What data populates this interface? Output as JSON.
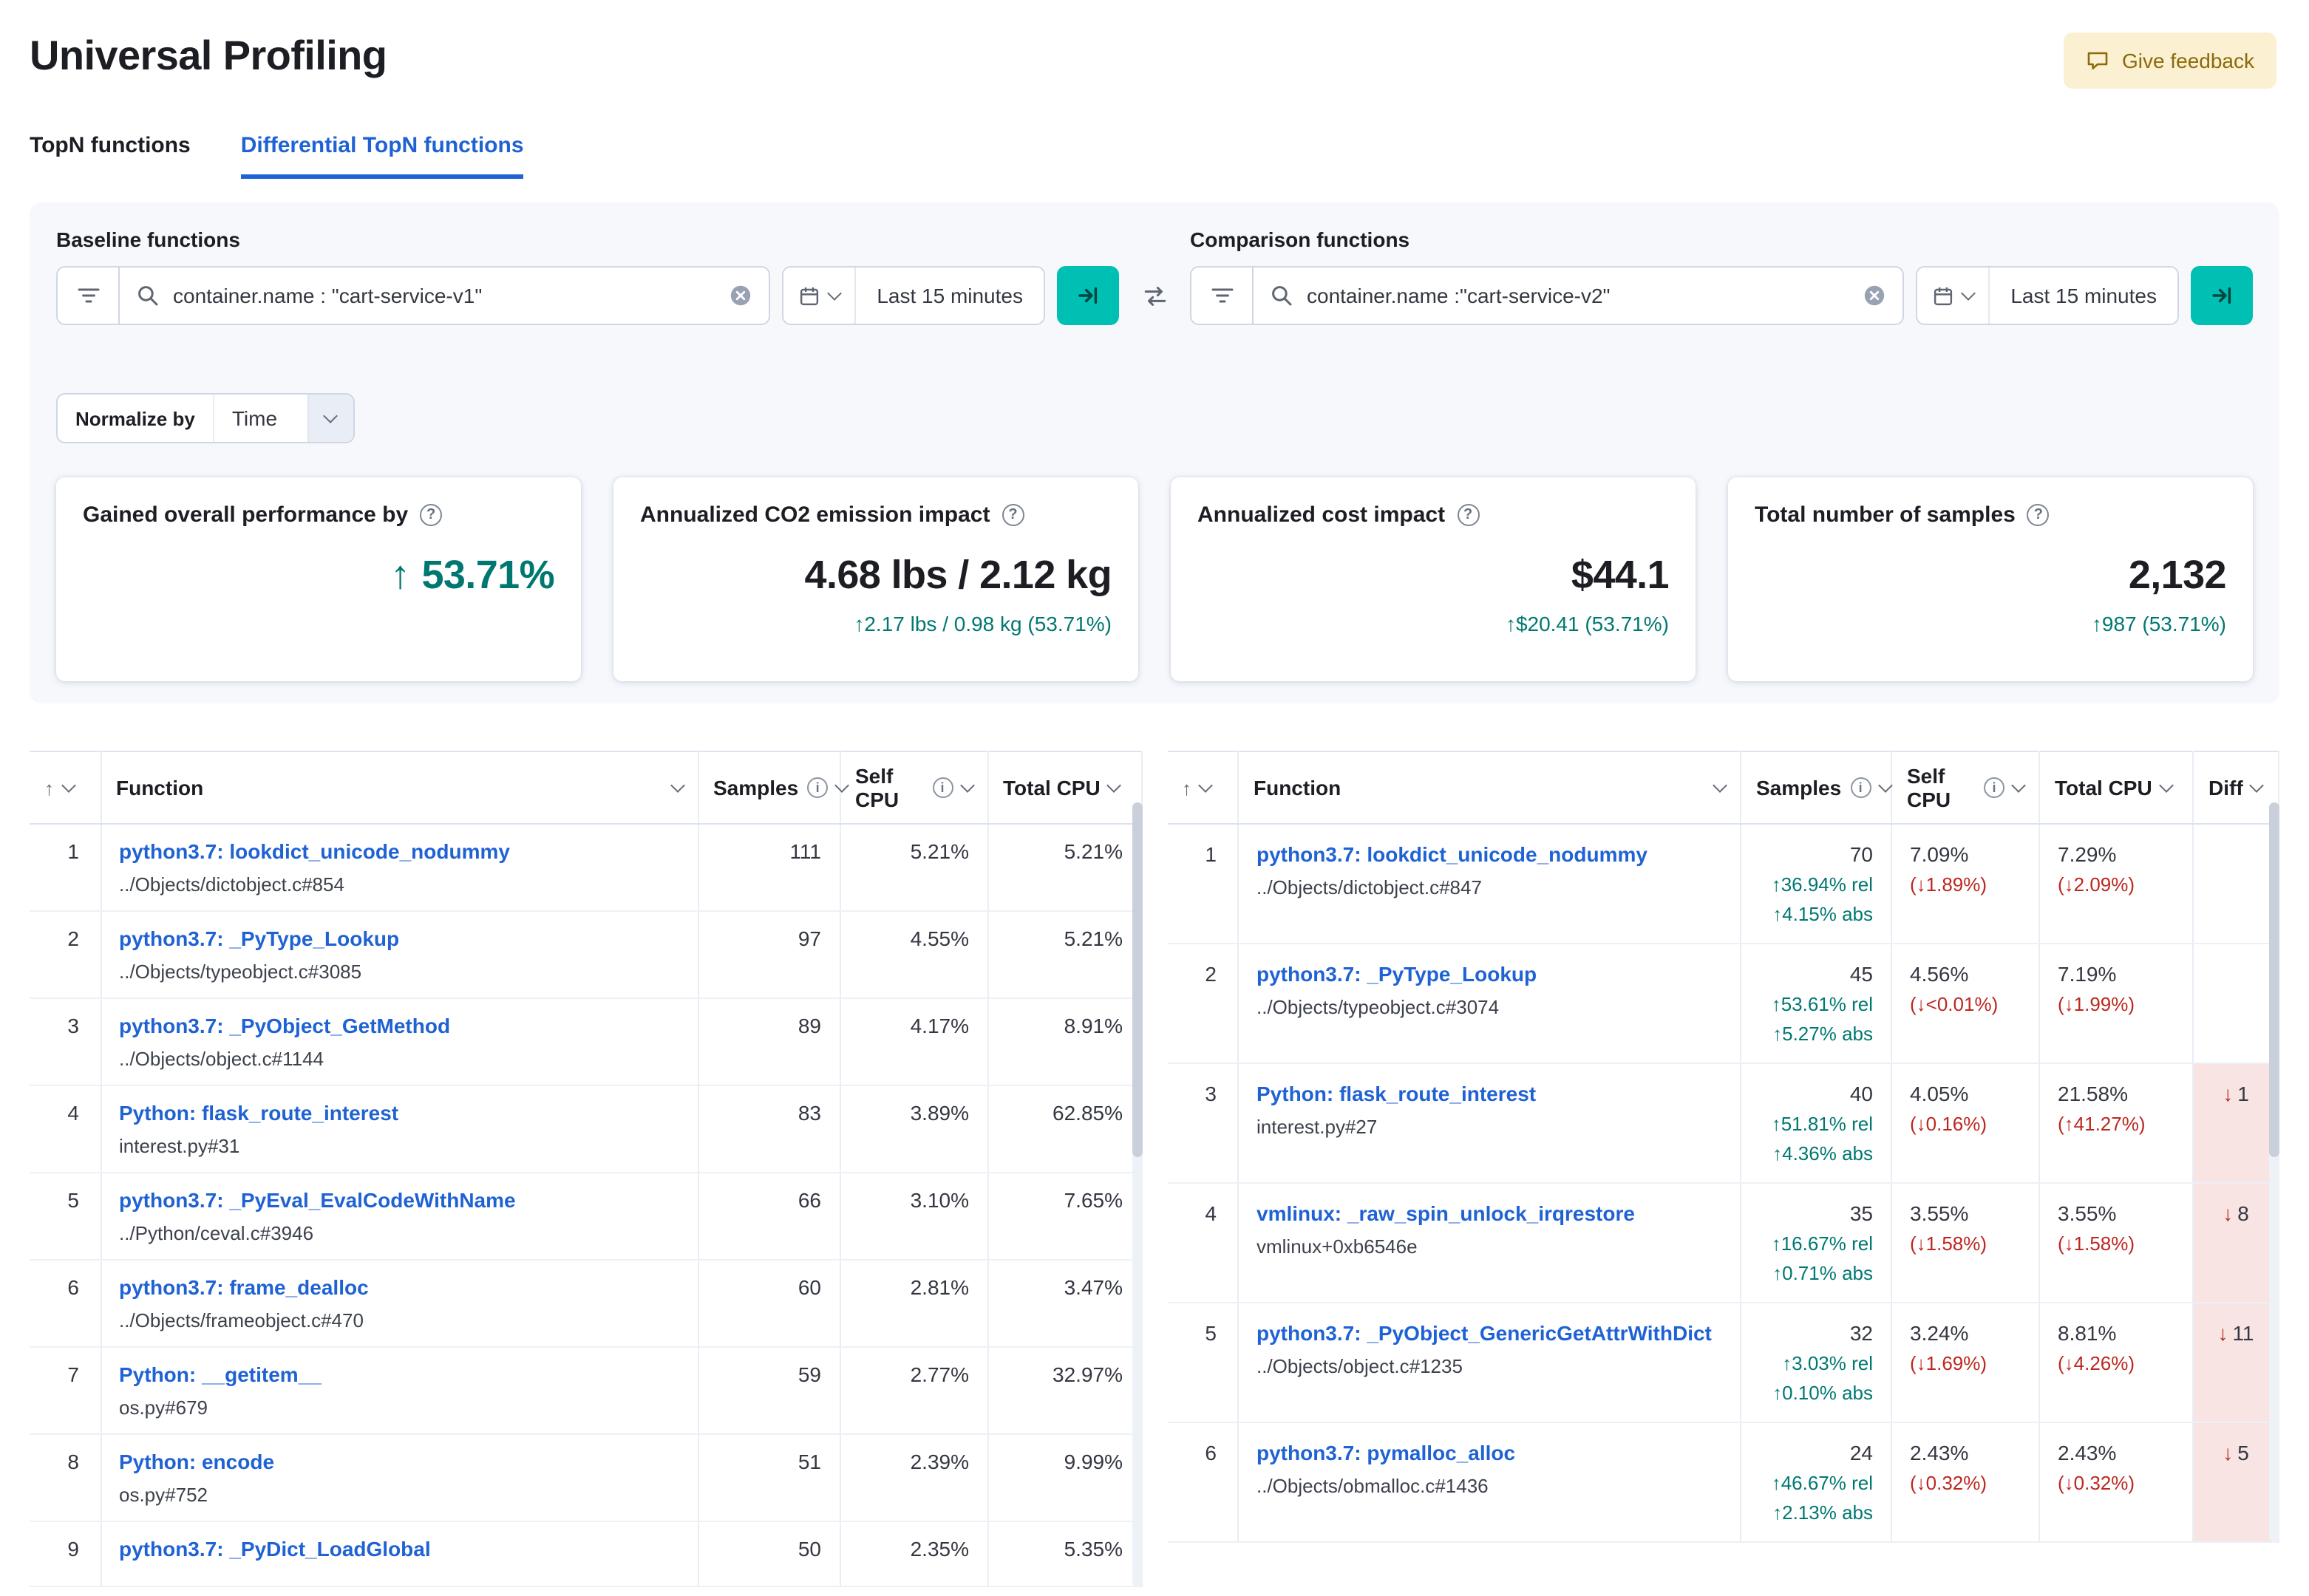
{
  "colors": {
    "accent_green": "#007871",
    "danger_red": "#bd271e",
    "link_blue": "#1f62d4",
    "teal_button": "#00bfb3",
    "diff_bad_bg": "#f7e4e3",
    "feedback_bg": "#fbf0d2",
    "feedback_text": "#8a6a0a",
    "panel_bg": "#f6f8fc"
  },
  "icons": {
    "help": "?",
    "info": "i",
    "sort_asc": "↑"
  },
  "header": {
    "title": "Universal Profiling",
    "feedback_label": "Give feedback"
  },
  "tabs": [
    {
      "label": "TopN functions"
    },
    {
      "label": "Differential TopN functions"
    }
  ],
  "baseline": {
    "label": "Baseline functions",
    "query": "container.name : \"cart-service-v1\"",
    "time_range": "Last 15 minutes"
  },
  "comparison": {
    "label": "Comparison functions",
    "query": "container.name :\"cart-service-v2\"",
    "time_range": "Last 15 minutes"
  },
  "normalize": {
    "label": "Normalize by",
    "value": "Time"
  },
  "cards": [
    {
      "title": "Gained overall performance by",
      "arrow": "↑",
      "value": "53.71%"
    },
    {
      "title": "Annualized CO2 emission impact",
      "value": "4.68 lbs / 2.12 kg",
      "delta": "↑2.17 lbs / 0.98 kg (53.71%)"
    },
    {
      "title": "Annualized cost impact",
      "value": "$44.1",
      "delta": "↑$20.41 (53.71%)"
    },
    {
      "title": "Total number of samples",
      "value": "2,132",
      "delta": "↑987 (53.71%)"
    }
  ],
  "baseline_table": {
    "headers": {
      "function": "Function",
      "samples": "Samples",
      "self_cpu": "Self CPU",
      "total_cpu": "Total CPU"
    },
    "rows": [
      {
        "rank": 1,
        "function": "python3.7: lookdict_unicode_nodummy",
        "file": "../Objects/dictobject.c#854",
        "samples": "111",
        "self_cpu": "5.21%",
        "total_cpu": "5.21%"
      },
      {
        "rank": 2,
        "function": "python3.7: _PyType_Lookup",
        "file": "../Objects/typeobject.c#3085",
        "samples": "97",
        "self_cpu": "4.55%",
        "total_cpu": "5.21%"
      },
      {
        "rank": 3,
        "function": "python3.7: _PyObject_GetMethod",
        "file": "../Objects/object.c#1144",
        "samples": "89",
        "self_cpu": "4.17%",
        "total_cpu": "8.91%"
      },
      {
        "rank": 4,
        "function": "Python: flask_route_interest",
        "file": "interest.py#31",
        "samples": "83",
        "self_cpu": "3.89%",
        "total_cpu": "62.85%"
      },
      {
        "rank": 5,
        "function": "python3.7: _PyEval_EvalCodeWithName",
        "file": "../Python/ceval.c#3946",
        "samples": "66",
        "self_cpu": "3.10%",
        "total_cpu": "7.65%"
      },
      {
        "rank": 6,
        "function": "python3.7: frame_dealloc",
        "file": "../Objects/frameobject.c#470",
        "samples": "60",
        "self_cpu": "2.81%",
        "total_cpu": "3.47%"
      },
      {
        "rank": 7,
        "function": "Python: __getitem__",
        "file": "os.py#679",
        "samples": "59",
        "self_cpu": "2.77%",
        "total_cpu": "32.97%"
      },
      {
        "rank": 8,
        "function": "Python: encode",
        "file": "os.py#752",
        "samples": "51",
        "self_cpu": "2.39%",
        "total_cpu": "9.99%"
      },
      {
        "rank": 9,
        "function": "python3.7: _PyDict_LoadGlobal",
        "file": "",
        "samples": "50",
        "self_cpu": "2.35%",
        "total_cpu": "5.35%"
      }
    ]
  },
  "comparison_table": {
    "headers": {
      "function": "Function",
      "samples": "Samples",
      "self_cpu": "Self CPU",
      "total_cpu": "Total CPU",
      "diff": "Diff"
    },
    "rows": [
      {
        "rank": 1,
        "function": "python3.7: lookdict_unicode_nodummy",
        "file": "../Objects/dictobject.c#847",
        "samples": "70",
        "samples_rel": "↑36.94% rel",
        "samples_abs": "↑4.15% abs",
        "self_cpu": "7.09%",
        "self_delta": "(↓1.89%)",
        "total_cpu": "7.29%",
        "total_delta": "(↓2.09%)",
        "diff_arrow": "",
        "diff_value": ""
      },
      {
        "rank": 2,
        "function": "python3.7: _PyType_Lookup",
        "file": "../Objects/typeobject.c#3074",
        "samples": "45",
        "samples_rel": "↑53.61% rel",
        "samples_abs": "↑5.27% abs",
        "self_cpu": "4.56%",
        "self_delta": "(↓<0.01%)",
        "total_cpu": "7.19%",
        "total_delta": "(↓1.99%)",
        "diff_arrow": "",
        "diff_value": ""
      },
      {
        "rank": 3,
        "function": "Python: flask_route_interest",
        "file": "interest.py#27",
        "samples": "40",
        "samples_rel": "↑51.81% rel",
        "samples_abs": "↑4.36% abs",
        "self_cpu": "4.05%",
        "self_delta": "(↓0.16%)",
        "total_cpu": "21.58%",
        "total_delta": "(↑41.27%)",
        "diff_arrow": "↓",
        "diff_value": "1"
      },
      {
        "rank": 4,
        "function": "vmlinux: _raw_spin_unlock_irqrestore",
        "file": "vmlinux+0xb6546e",
        "samples": "35",
        "samples_rel": "↑16.67% rel",
        "samples_abs": "↑0.71% abs",
        "self_cpu": "3.55%",
        "self_delta": "(↓1.58%)",
        "total_cpu": "3.55%",
        "total_delta": "(↓1.58%)",
        "diff_arrow": "↓",
        "diff_value": "8"
      },
      {
        "rank": 5,
        "function": "python3.7: _PyObject_GenericGetAttrWithDict",
        "file": "../Objects/object.c#1235",
        "samples": "32",
        "samples_rel": "↑3.03% rel",
        "samples_abs": "↑0.10% abs",
        "self_cpu": "3.24%",
        "self_delta": "(↓1.69%)",
        "total_cpu": "8.81%",
        "total_delta": "(↓4.26%)",
        "diff_arrow": "↓",
        "diff_value": "11"
      },
      {
        "rank": 6,
        "function": "python3.7: pymalloc_alloc",
        "file": "../Objects/obmalloc.c#1436",
        "samples": "24",
        "samples_rel": "↑46.67% rel",
        "samples_abs": "↑2.13% abs",
        "self_cpu": "2.43%",
        "self_delta": "(↓0.32%)",
        "total_cpu": "2.43%",
        "total_delta": "(↓0.32%)",
        "diff_arrow": "↓",
        "diff_value": "5"
      }
    ]
  }
}
